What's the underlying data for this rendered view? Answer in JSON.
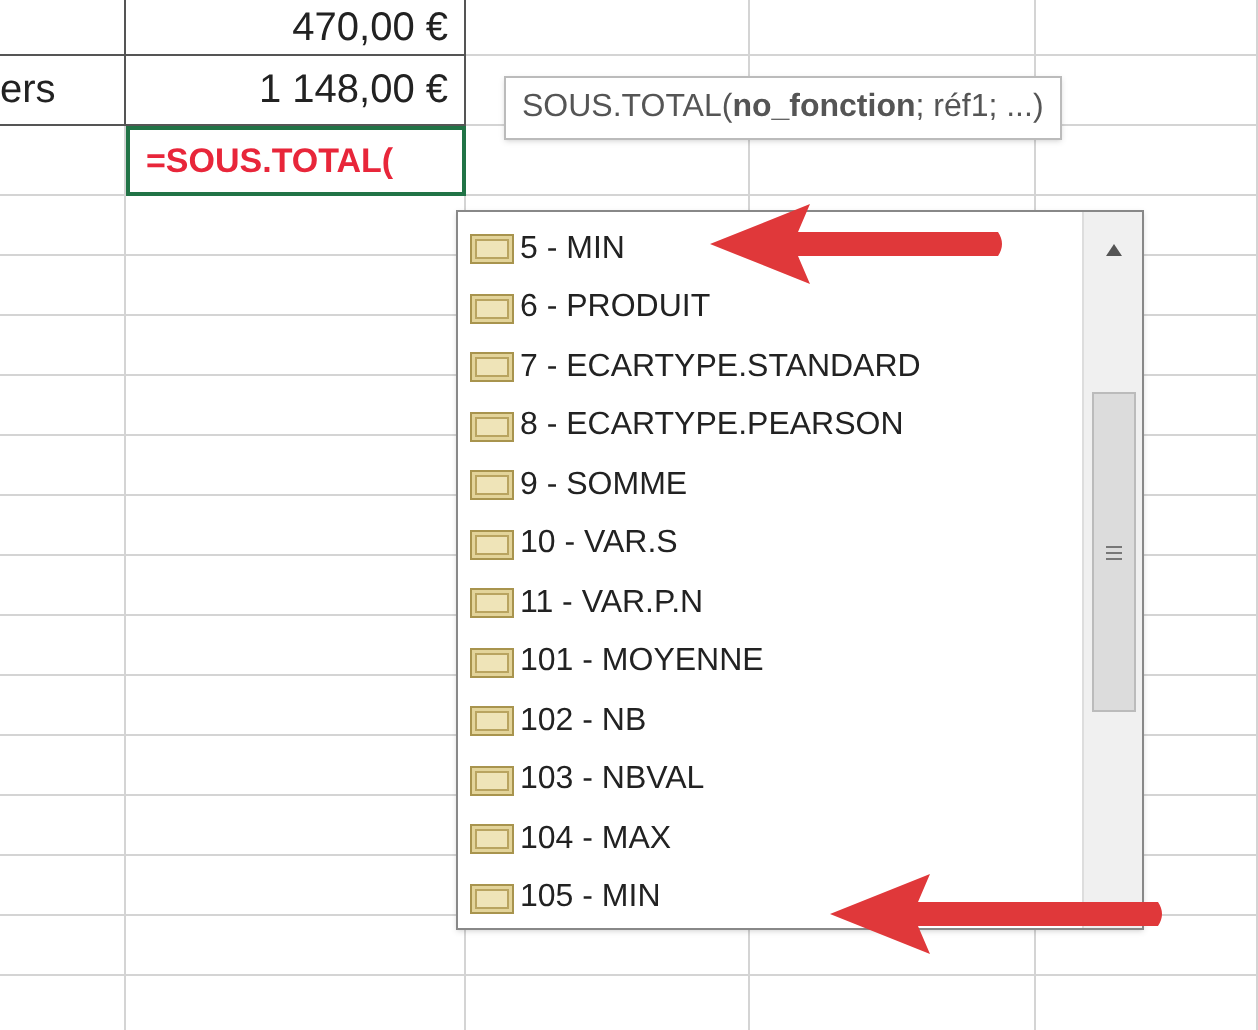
{
  "sheet": {
    "rows": [
      {
        "amount": "470,00 €"
      },
      {
        "label": "ers",
        "amount": "1 148,00 €"
      }
    ],
    "formula": "=SOUS.TOTAL("
  },
  "tooltip": {
    "text": "SOUS.TOTAL(**no_fonction**; réf1; ...)"
  },
  "autocomplete": {
    "items": [
      {
        "label": "5 - MIN"
      },
      {
        "label": "6 - PRODUIT"
      },
      {
        "label": "7 - ECARTYPE.STANDARD"
      },
      {
        "label": "8 - ECARTYPE.PEARSON"
      },
      {
        "label": "9 - SOMME"
      },
      {
        "label": "10 - VAR.S"
      },
      {
        "label": "11 - VAR.P.N"
      },
      {
        "label": "101 - MOYENNE"
      },
      {
        "label": "102 - NB"
      },
      {
        "label": "103 - NBVAL"
      },
      {
        "label": "104 - MAX"
      },
      {
        "label": "105 - MIN"
      }
    ]
  }
}
